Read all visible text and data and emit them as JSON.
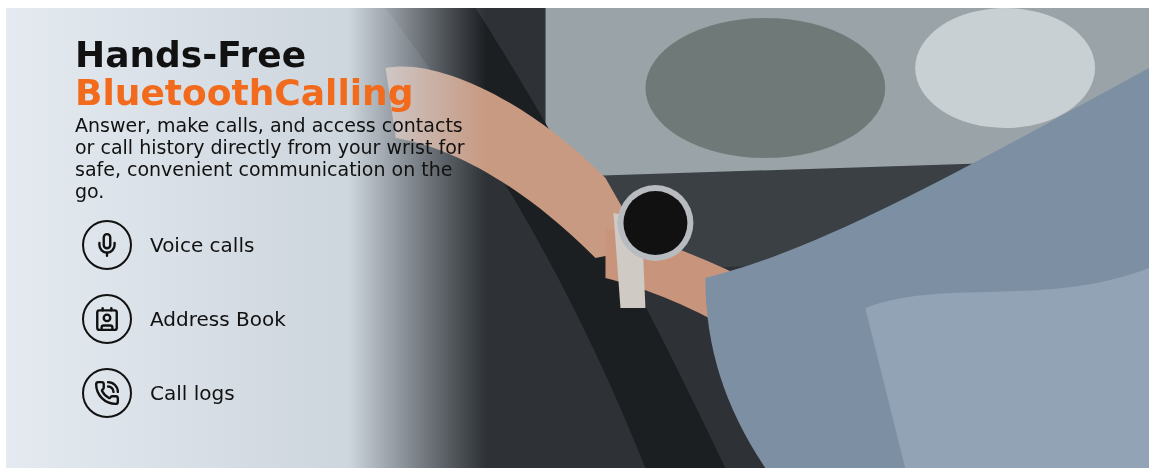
{
  "banner": {
    "title": "Hands-Free",
    "title_highlight": "BluetoothCalling",
    "description": "Answer, make calls, and access contacts or call history directly from your wrist for safe, convenient communication on the go.",
    "features": [
      {
        "kind": "microphone",
        "label": "Voice calls"
      },
      {
        "kind": "contact",
        "label": "Address Book"
      },
      {
        "kind": "phone",
        "label": "Call logs"
      }
    ]
  }
}
